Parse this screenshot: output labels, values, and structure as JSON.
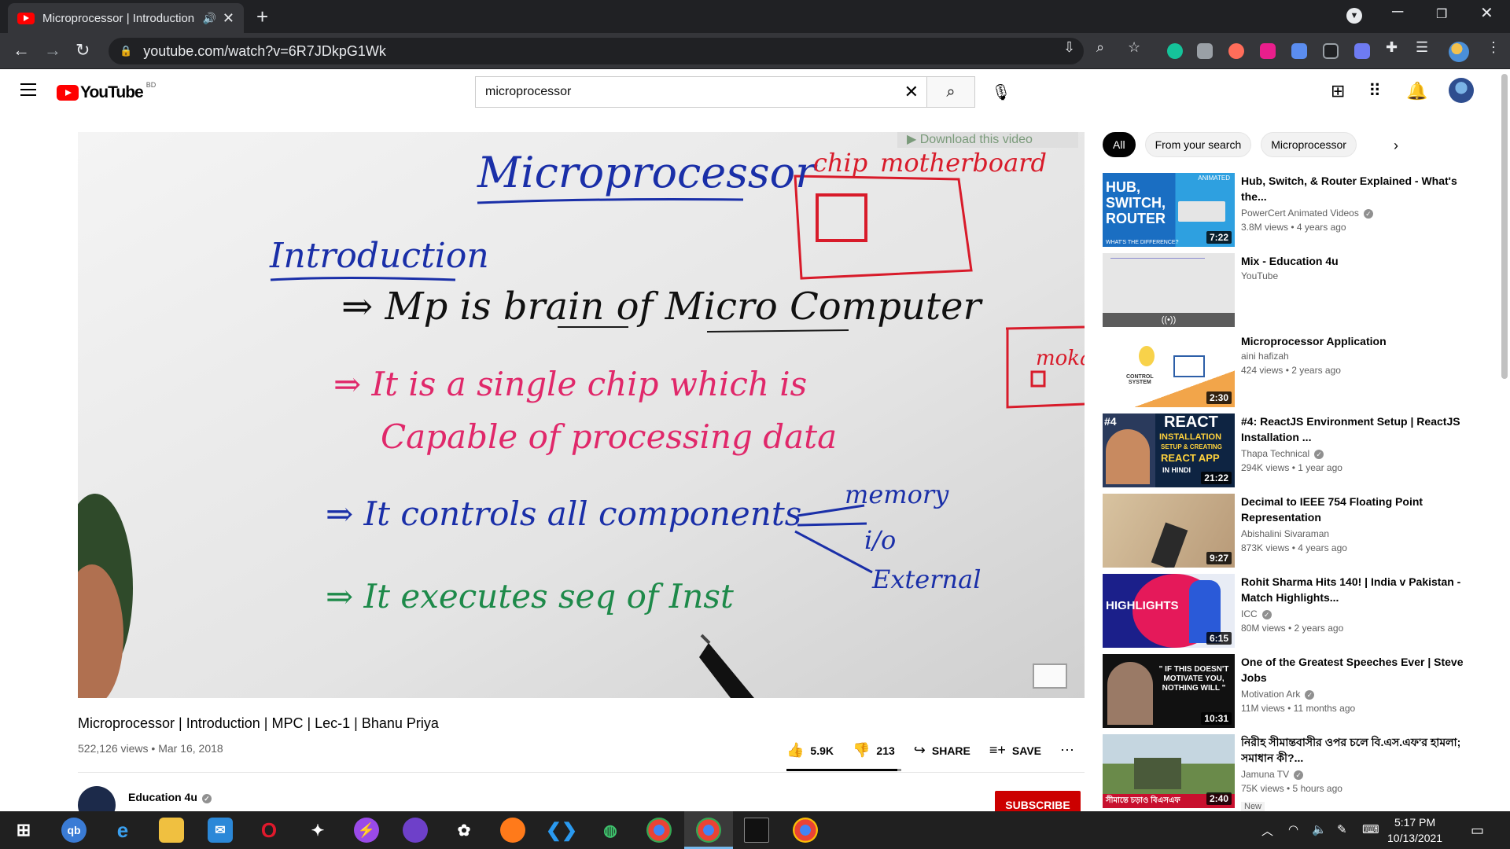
{
  "browser": {
    "tab_title": "Microprocessor | Introduction | MP",
    "url": "youtube.com/watch?v=6R7JDkpG1Wk"
  },
  "youtube": {
    "logo_text": "YouTube",
    "country_code": "BD",
    "search": {
      "value": "microprocessor"
    }
  },
  "video": {
    "overlay_download": "Download this video",
    "board_text": {
      "heading": "Microprocessor",
      "chip": "chip",
      "motherboard": "motherboard",
      "intro": "Introduction",
      "line1": "⇒ Mp is brain of Micro Computer",
      "line2a": "⇒ It is a single chip which is",
      "line2b": "Capable of processing data",
      "line3": "⇒ It controls all components",
      "memory": "memory",
      "io": "i/o",
      "external": "External",
      "line4": "⇒ It executes seq of Inst",
      "side": "moka"
    },
    "title": "Microprocessor | Introduction | MPC | Lec-1 | Bhanu Priya",
    "views": "522,126 views",
    "date": "Mar 16, 2018",
    "likes": "5.9K",
    "dislikes": "213",
    "share_label": "SHARE",
    "save_label": "SAVE",
    "like_ratio": 0.965,
    "channel_name": "Education 4u",
    "subscribe_label": "SUBSCRIBE"
  },
  "sidebar": {
    "chips": [
      "All",
      "From your search",
      "Microprocessor"
    ],
    "recommendations": [
      {
        "title": "Hub, Switch, & Router Explained - What's the...",
        "channel": "PowerCert Animated Videos",
        "verified": true,
        "meta": "3.8M views • 4 years ago",
        "duration": "7:22"
      },
      {
        "title": "Mix - Education 4u",
        "channel": "YouTube",
        "verified": false,
        "meta": "",
        "duration": ""
      },
      {
        "title": "Microprocessor Application",
        "channel": "aini hafizah",
        "verified": false,
        "meta": "424 views • 2 years ago",
        "duration": "2:30"
      },
      {
        "title": "#4: ReactJS Environment Setup | ReactJS Installation ...",
        "channel": "Thapa Technical",
        "verified": true,
        "meta": "294K views • 1 year ago",
        "duration": "21:22"
      },
      {
        "title": "Decimal to IEEE 754 Floating Point Representation",
        "channel": "Abishalini Sivaraman",
        "verified": false,
        "meta": "873K views • 4 years ago",
        "duration": "9:27"
      },
      {
        "title": "Rohit Sharma Hits 140! | India v Pakistan - Match Highlights...",
        "channel": "ICC",
        "verified": true,
        "meta": "80M views • 2 years ago",
        "duration": "6:15"
      },
      {
        "title": "One of the Greatest Speeches Ever | Steve Jobs",
        "channel": "Motivation Ark",
        "verified": true,
        "meta": "11M views • 11 months ago",
        "duration": "10:31"
      },
      {
        "title": "নিরীহ সীমান্তবাসীর ওপর চলে বি.এস.এফ'র হামলা; সমাধান কী?...",
        "channel": "Jamuna TV",
        "verified": true,
        "meta": "75K views • 5 hours ago",
        "duration": "2:40",
        "badge": "New"
      }
    ],
    "thumb_texts": {
      "hub": "HUB,\nSWITCH,\nROUTER",
      "hub_top": "ANIMATED",
      "hub_sub": "WHAT'S THE DIFFERENCE?",
      "control": "CONTROL\nSYSTEM",
      "react_num": "#4",
      "react_big": "REACT",
      "react_l2": "INSTALLATION",
      "react_l3": "SETUP & CREATING",
      "react_l4": "REACT APP",
      "react_l5": "IN HINDI",
      "highlights": "HIGHLIGHTS",
      "jobs": "\" IF THIS DOESN'T\nMOTIVATE YOU,\nNOTHING WILL \"",
      "jamuna": "সীমান্তে চড়াও বিএসএফ"
    }
  },
  "taskbar": {
    "time": "5:17 PM",
    "date": "10/13/2021"
  },
  "icons": {
    "tab_audio": "speaker-icon",
    "tab_close": "close-icon",
    "new_tab": "plus-icon",
    "back": "arrow-left-icon",
    "forward": "arrow-right-icon",
    "reload": "reload-icon",
    "lock": "lock-icon"
  }
}
